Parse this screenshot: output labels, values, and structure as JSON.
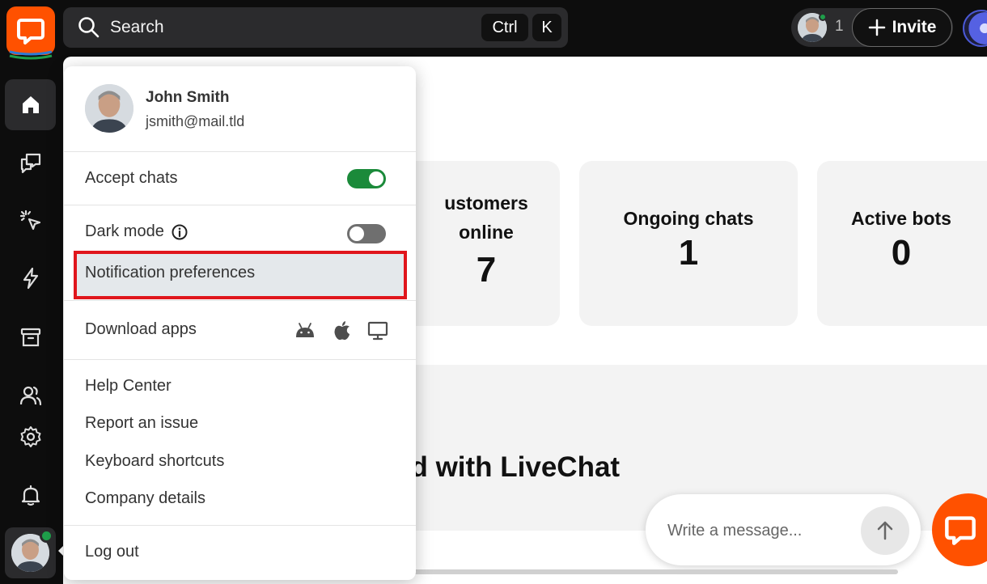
{
  "search": {
    "label": "Search",
    "shortcut_ctrl": "Ctrl",
    "shortcut_k": "K"
  },
  "topbar": {
    "online_count": "1",
    "invite_label": "Invite"
  },
  "sidebar": {
    "items": [
      "home-icon",
      "chats-icon",
      "engage-icon",
      "automate-icon",
      "archives-icon",
      "team-icon",
      "settings-icon",
      "notifications-icon"
    ]
  },
  "dashboard": {
    "cards": [
      {
        "title_line1": "ustomers",
        "title_line2": "online",
        "value": "7"
      },
      {
        "title": "Ongoing chats",
        "value": "1"
      },
      {
        "title": "Active bots",
        "value": "0"
      }
    ],
    "headline": "ed with LiveChat",
    "composer_placeholder": "Write a message..."
  },
  "menu": {
    "name": "John Smith",
    "email": "jsmith@mail.tld",
    "accept_chats": "Accept chats",
    "accept_chats_on": true,
    "dark_mode": "Dark mode",
    "dark_mode_on": false,
    "notification_preferences": "Notification preferences",
    "download_apps": "Download apps",
    "help_center": "Help Center",
    "report_issue": "Report an issue",
    "keyboard_shortcuts": "Keyboard shortcuts",
    "company_details": "Company details",
    "log_out": "Log out"
  },
  "colors": {
    "brand": "#ff5100",
    "online": "#1e9e4a",
    "highlight": "#e0161c"
  }
}
